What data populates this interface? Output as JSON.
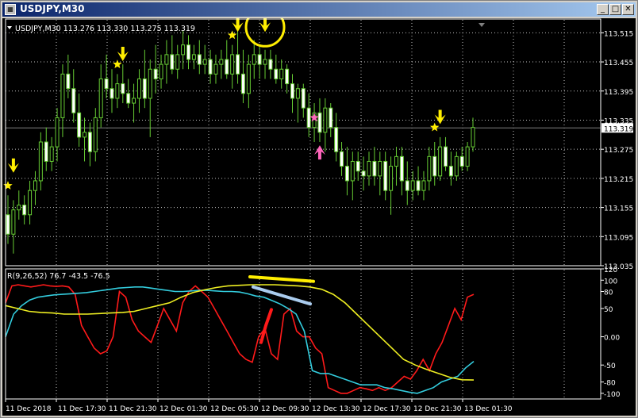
{
  "window": {
    "title": "USDJPY,M30",
    "minimize_glyph": "_",
    "maximize_glyph": "□",
    "close_glyph": "✕"
  },
  "colors": {
    "background": "#000000",
    "grid": "#c0c0c0",
    "candle": "#66cc33",
    "axis_text": "#ffffff",
    "rsi_red": "#ff1a1a",
    "rsi_cyan": "#33ccdd",
    "rsi_yellow": "#eeee22",
    "marker_yellow": "#ffee00",
    "marker_pink": "#ff66bb",
    "annotation_blue": "#aaccee"
  },
  "main_chart": {
    "info_label": "USDJPY,M30  113.276 113.330 113.275 113.319",
    "current_price": "113.319",
    "price_axis": [
      "113.515",
      "113.455",
      "113.395",
      "113.335",
      "113.275",
      "113.215",
      "113.155",
      "113.095",
      "113.035"
    ]
  },
  "indicator": {
    "label": "R(9,26,52) 76.7 -43.5 -76.5",
    "axis": [
      "120",
      "100",
      "80",
      "50",
      "0.00",
      "-50",
      "-80",
      "-100"
    ]
  },
  "time_axis": [
    "11 Dec 2018",
    "11 Dec 17:30",
    "11 Dec 21:30",
    "12 Dec 01:30",
    "12 Dec 05:30",
    "12 Dec 09:30",
    "12 Dec 13:30",
    "12 Dec 17:30",
    "12 Dec 21:30",
    "13 Dec 01:30"
  ],
  "chart_data": {
    "type": "candlestick",
    "symbol": "USDJPY",
    "timeframe": "M30",
    "ylim": [
      113.035,
      113.545
    ],
    "candles": [
      {
        "o": 113.14,
        "h": 113.18,
        "l": 113.08,
        "c": 113.1
      },
      {
        "o": 113.1,
        "h": 113.17,
        "l": 113.06,
        "c": 113.15
      },
      {
        "o": 113.15,
        "h": 113.19,
        "l": 113.13,
        "c": 113.16
      },
      {
        "o": 113.16,
        "h": 113.18,
        "l": 113.12,
        "c": 113.14
      },
      {
        "o": 113.14,
        "h": 113.21,
        "l": 113.12,
        "c": 113.19
      },
      {
        "o": 113.19,
        "h": 113.23,
        "l": 113.16,
        "c": 113.21
      },
      {
        "o": 113.21,
        "h": 113.31,
        "l": 113.19,
        "c": 113.29
      },
      {
        "o": 113.29,
        "h": 113.32,
        "l": 113.23,
        "c": 113.25
      },
      {
        "o": 113.25,
        "h": 113.3,
        "l": 113.23,
        "c": 113.28
      },
      {
        "o": 113.28,
        "h": 113.36,
        "l": 113.25,
        "c": 113.34
      },
      {
        "o": 113.34,
        "h": 113.45,
        "l": 113.3,
        "c": 113.43
      },
      {
        "o": 113.43,
        "h": 113.47,
        "l": 113.38,
        "c": 113.4
      },
      {
        "o": 113.4,
        "h": 113.44,
        "l": 113.33,
        "c": 113.35
      },
      {
        "o": 113.35,
        "h": 113.39,
        "l": 113.28,
        "c": 113.3
      },
      {
        "o": 113.3,
        "h": 113.34,
        "l": 113.25,
        "c": 113.31
      },
      {
        "o": 113.31,
        "h": 113.33,
        "l": 113.24,
        "c": 113.27
      },
      {
        "o": 113.27,
        "h": 113.36,
        "l": 113.25,
        "c": 113.34
      },
      {
        "o": 113.34,
        "h": 113.45,
        "l": 113.32,
        "c": 113.42
      },
      {
        "o": 113.42,
        "h": 113.47,
        "l": 113.38,
        "c": 113.4
      },
      {
        "o": 113.4,
        "h": 113.44,
        "l": 113.35,
        "c": 113.38
      },
      {
        "o": 113.38,
        "h": 113.43,
        "l": 113.36,
        "c": 113.41
      },
      {
        "o": 113.41,
        "h": 113.45,
        "l": 113.37,
        "c": 113.39
      },
      {
        "o": 113.39,
        "h": 113.42,
        "l": 113.36,
        "c": 113.37
      },
      {
        "o": 113.37,
        "h": 113.41,
        "l": 113.33,
        "c": 113.38
      },
      {
        "o": 113.38,
        "h": 113.44,
        "l": 113.35,
        "c": 113.42
      },
      {
        "o": 113.42,
        "h": 113.48,
        "l": 113.36,
        "c": 113.38
      },
      {
        "o": 113.38,
        "h": 113.46,
        "l": 113.3,
        "c": 113.44
      },
      {
        "o": 113.44,
        "h": 113.49,
        "l": 113.39,
        "c": 113.42
      },
      {
        "o": 113.42,
        "h": 113.47,
        "l": 113.4,
        "c": 113.45
      },
      {
        "o": 113.45,
        "h": 113.5,
        "l": 113.41,
        "c": 113.47
      },
      {
        "o": 113.47,
        "h": 113.51,
        "l": 113.43,
        "c": 113.44
      },
      {
        "o": 113.44,
        "h": 113.49,
        "l": 113.42,
        "c": 113.47
      },
      {
        "o": 113.47,
        "h": 113.52,
        "l": 113.44,
        "c": 113.49
      },
      {
        "o": 113.49,
        "h": 113.51,
        "l": 113.44,
        "c": 113.46
      },
      {
        "o": 113.46,
        "h": 113.49,
        "l": 113.44,
        "c": 113.47
      },
      {
        "o": 113.47,
        "h": 113.5,
        "l": 113.43,
        "c": 113.45
      },
      {
        "o": 113.45,
        "h": 113.49,
        "l": 113.43,
        "c": 113.46
      },
      {
        "o": 113.46,
        "h": 113.48,
        "l": 113.41,
        "c": 113.43
      },
      {
        "o": 113.43,
        "h": 113.47,
        "l": 113.41,
        "c": 113.45
      },
      {
        "o": 113.45,
        "h": 113.48,
        "l": 113.42,
        "c": 113.46
      },
      {
        "o": 113.46,
        "h": 113.5,
        "l": 113.42,
        "c": 113.43
      },
      {
        "o": 113.43,
        "h": 113.49,
        "l": 113.4,
        "c": 113.47
      },
      {
        "o": 113.47,
        "h": 113.52,
        "l": 113.41,
        "c": 113.43
      },
      {
        "o": 113.43,
        "h": 113.48,
        "l": 113.37,
        "c": 113.39
      },
      {
        "o": 113.39,
        "h": 113.47,
        "l": 113.36,
        "c": 113.45
      },
      {
        "o": 113.45,
        "h": 113.5,
        "l": 113.42,
        "c": 113.47
      },
      {
        "o": 113.47,
        "h": 113.49,
        "l": 113.42,
        "c": 113.45
      },
      {
        "o": 113.45,
        "h": 113.48,
        "l": 113.42,
        "c": 113.46
      },
      {
        "o": 113.46,
        "h": 113.48,
        "l": 113.42,
        "c": 113.44
      },
      {
        "o": 113.44,
        "h": 113.47,
        "l": 113.41,
        "c": 113.42
      },
      {
        "o": 113.42,
        "h": 113.46,
        "l": 113.4,
        "c": 113.44
      },
      {
        "o": 113.44,
        "h": 113.45,
        "l": 113.39,
        "c": 113.41
      },
      {
        "o": 113.41,
        "h": 113.43,
        "l": 113.35,
        "c": 113.38
      },
      {
        "o": 113.38,
        "h": 113.41,
        "l": 113.33,
        "c": 113.4
      },
      {
        "o": 113.4,
        "h": 113.41,
        "l": 113.34,
        "c": 113.36
      },
      {
        "o": 113.36,
        "h": 113.39,
        "l": 113.3,
        "c": 113.32
      },
      {
        "o": 113.32,
        "h": 113.37,
        "l": 113.29,
        "c": 113.35
      },
      {
        "o": 113.35,
        "h": 113.38,
        "l": 113.29,
        "c": 113.31
      },
      {
        "o": 113.31,
        "h": 113.38,
        "l": 113.27,
        "c": 113.36
      },
      {
        "o": 113.36,
        "h": 113.37,
        "l": 113.3,
        "c": 113.32
      },
      {
        "o": 113.32,
        "h": 113.35,
        "l": 113.25,
        "c": 113.27
      },
      {
        "o": 113.27,
        "h": 113.29,
        "l": 113.22,
        "c": 113.24
      },
      {
        "o": 113.24,
        "h": 113.28,
        "l": 113.18,
        "c": 113.21
      },
      {
        "o": 113.21,
        "h": 113.27,
        "l": 113.17,
        "c": 113.25
      },
      {
        "o": 113.25,
        "h": 113.27,
        "l": 113.21,
        "c": 113.23
      },
      {
        "o": 113.23,
        "h": 113.26,
        "l": 113.19,
        "c": 113.22
      },
      {
        "o": 113.22,
        "h": 113.27,
        "l": 113.2,
        "c": 113.25
      },
      {
        "o": 113.25,
        "h": 113.28,
        "l": 113.2,
        "c": 113.22
      },
      {
        "o": 113.22,
        "h": 113.27,
        "l": 113.18,
        "c": 113.25
      },
      {
        "o": 113.25,
        "h": 113.27,
        "l": 113.17,
        "c": 113.19
      },
      {
        "o": 113.19,
        "h": 113.26,
        "l": 113.14,
        "c": 113.24
      },
      {
        "o": 113.24,
        "h": 113.28,
        "l": 113.2,
        "c": 113.26
      },
      {
        "o": 113.26,
        "h": 113.28,
        "l": 113.18,
        "c": 113.21
      },
      {
        "o": 113.21,
        "h": 113.25,
        "l": 113.16,
        "c": 113.19
      },
      {
        "o": 113.19,
        "h": 113.23,
        "l": 113.17,
        "c": 113.21
      },
      {
        "o": 113.21,
        "h": 113.24,
        "l": 113.18,
        "c": 113.19
      },
      {
        "o": 113.19,
        "h": 113.23,
        "l": 113.17,
        "c": 113.21
      },
      {
        "o": 113.21,
        "h": 113.28,
        "l": 113.19,
        "c": 113.26
      },
      {
        "o": 113.26,
        "h": 113.29,
        "l": 113.2,
        "c": 113.22
      },
      {
        "o": 113.22,
        "h": 113.3,
        "l": 113.21,
        "c": 113.28
      },
      {
        "o": 113.28,
        "h": 113.3,
        "l": 113.23,
        "c": 113.24
      },
      {
        "o": 113.24,
        "h": 113.27,
        "l": 113.2,
        "c": 113.22
      },
      {
        "o": 113.22,
        "h": 113.27,
        "l": 113.21,
        "c": 113.26
      },
      {
        "o": 113.26,
        "h": 113.28,
        "l": 113.23,
        "c": 113.24
      },
      {
        "o": 113.24,
        "h": 113.29,
        "l": 113.23,
        "c": 113.28
      },
      {
        "o": 113.28,
        "h": 113.34,
        "l": 113.27,
        "c": 113.32
      }
    ],
    "rsi_ylim": [
      -110,
      120
    ],
    "rsi_series": [
      {
        "name": "R9",
        "color": "#ff1a1a",
        "values": [
          60,
          90,
          92,
          90,
          88,
          90,
          92,
          90,
          89,
          90,
          88,
          75,
          20,
          0,
          -20,
          -30,
          -25,
          0,
          80,
          70,
          30,
          10,
          0,
          -10,
          20,
          50,
          30,
          10,
          60,
          80,
          90,
          80,
          70,
          50,
          30,
          10,
          -10,
          -30,
          -40,
          -45,
          0,
          15,
          -30,
          -40,
          40,
          50,
          10,
          0,
          0,
          -20,
          -30,
          -90,
          -95,
          -100,
          -100,
          -95,
          -90,
          -92,
          -95,
          -90,
          -95,
          -90,
          -80,
          -70,
          -75,
          -60,
          -40,
          -60,
          -30,
          -10,
          20,
          50,
          30,
          70,
          75
        ]
      },
      {
        "name": "R26",
        "color": "#33ccdd",
        "values": [
          0,
          40,
          55,
          65,
          70,
          72,
          74,
          75,
          76,
          77,
          78,
          80,
          82,
          84,
          86,
          87,
          88,
          88,
          86,
          84,
          82,
          80,
          80,
          81,
          82,
          82,
          81,
          80,
          80,
          79,
          76,
          72,
          70,
          64,
          58,
          50,
          40,
          10,
          -60,
          -65,
          -65,
          -70,
          -75,
          -80,
          -85,
          -85,
          -85,
          -90,
          -92,
          -95,
          -98,
          -100,
          -95,
          -90,
          -80,
          -75,
          -70,
          -55,
          -43.5
        ]
      },
      {
        "name": "R52",
        "color": "#eeee22",
        "values": [
          55,
          50,
          45,
          43,
          42,
          40,
          40,
          40,
          41,
          42,
          43,
          45,
          50,
          55,
          60,
          70,
          78,
          83,
          87,
          90,
          91,
          92,
          92,
          92,
          91,
          90,
          88,
          84,
          75,
          60,
          40,
          20,
          0,
          -20,
          -40,
          -50,
          -58,
          -65,
          -72,
          -76,
          -76.5
        ]
      }
    ]
  },
  "markers": [
    {
      "kind": "yellow-arrow",
      "candle": 1,
      "price": 113.23
    },
    {
      "kind": "yellow-star",
      "candle": 0,
      "price": 113.2
    },
    {
      "kind": "yellow-arrow",
      "candle": 21,
      "price": 113.46
    },
    {
      "kind": "yellow-star",
      "candle": 20,
      "price": 113.45
    },
    {
      "kind": "yellow-arrow",
      "candle": 42,
      "price": 113.52
    },
    {
      "kind": "yellow-star",
      "candle": 41,
      "price": 113.51
    },
    {
      "kind": "yellow-arrow",
      "candle": 47,
      "price": 113.52
    },
    {
      "kind": "yellow-arrow",
      "candle": 79,
      "price": 113.33
    },
    {
      "kind": "yellow-star",
      "candle": 78,
      "price": 113.32
    },
    {
      "kind": "pink-star",
      "candle": 56,
      "price": 113.34
    },
    {
      "kind": "pink-arrow",
      "candle": 57,
      "price": 113.28
    }
  ]
}
